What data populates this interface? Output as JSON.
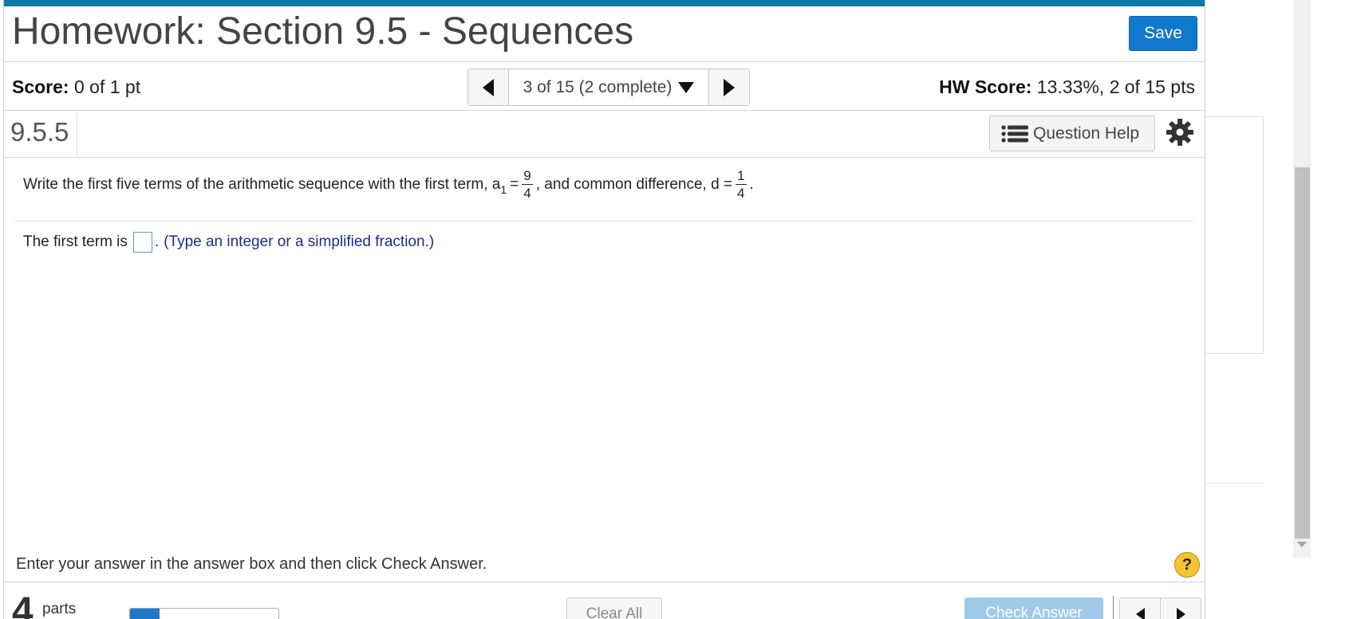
{
  "header": {
    "title": "Homework: Section 9.5 - Sequences",
    "save_label": "Save"
  },
  "status": {
    "score_label": "Score:",
    "score_value": "0 of 1 pt",
    "hw_score_label": "HW Score:",
    "hw_score_value": "13.33%, 2 of 15 pts"
  },
  "navigator": {
    "position_text": "3 of 15 (2 complete)"
  },
  "question": {
    "number": "9.5.5",
    "help_label": "Question Help",
    "prompt_start": "Write the first five terms of the arithmetic sequence with the first term, a",
    "subscript": "1",
    "equals1": "=",
    "a1_numerator": "9",
    "a1_denominator": "4",
    "prompt_middle": ", and common difference, d =",
    "d_numerator": "1",
    "d_denominator": "4",
    "prompt_end": ".",
    "answer_prefix": "The first term is",
    "answer_suffix": ".",
    "hint": "(Type an integer or a simplified fraction.)"
  },
  "footer": {
    "instruction": "Enter your answer in the answer box and then click Check Answer.",
    "help_symbol": "?",
    "parts_count": "4",
    "parts_label": "parts",
    "parts_progress": 0.2,
    "clear_all_label": "Clear All",
    "check_answer_label": "Check Answer"
  },
  "colors": {
    "topbar": "#0e7aa5",
    "save_button": "#1079cc",
    "hint_text": "#1a2d8c",
    "check_answer_disabled": "#9fc9e8",
    "help_circle": "#f2c432"
  }
}
